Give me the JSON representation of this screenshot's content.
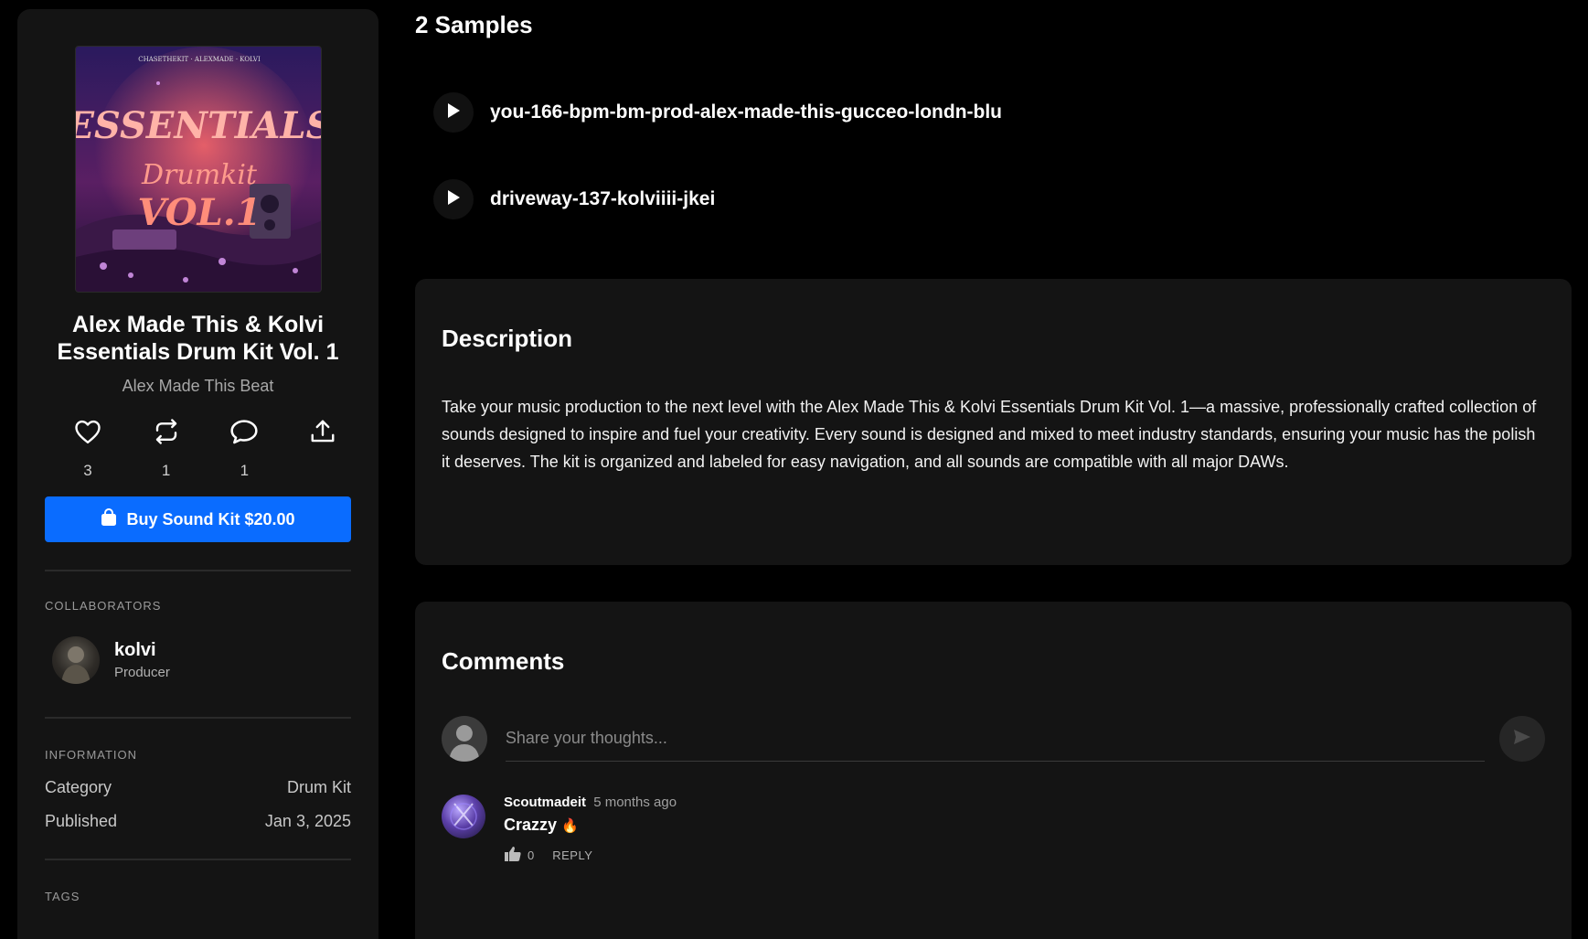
{
  "kit": {
    "title_line1": "Alex Made This & Kolvi",
    "title_line2": "Essentials Drum Kit Vol. 1",
    "author": "Alex Made This Beat",
    "cover_text": "ESSENTIALS"
  },
  "actions": [
    {
      "icon": "heart-icon",
      "count": "3"
    },
    {
      "icon": "repost-icon",
      "count": "1"
    },
    {
      "icon": "comment-icon",
      "count": "1"
    },
    {
      "icon": "share-icon",
      "count": ""
    }
  ],
  "buy": {
    "label": "Buy Sound Kit $20.00"
  },
  "collaborators": {
    "label": "COLLABORATORS",
    "items": [
      {
        "name": "kolvi",
        "role": "Producer"
      }
    ]
  },
  "information": {
    "label": "INFORMATION",
    "rows": [
      {
        "key": "Category",
        "value": "Drum Kit"
      },
      {
        "key": "Published",
        "value": "Jan 3, 2025"
      }
    ]
  },
  "tags": {
    "label": "TAGS"
  },
  "samples": {
    "title": "2 Samples",
    "items": [
      {
        "name": "you-166-bpm-bm-prod-alex-made-this-gucceo-londn-blu"
      },
      {
        "name": "driveway-137-kolviiii-jkei"
      }
    ]
  },
  "description": {
    "title": "Description",
    "text": "Take your music production to the next level with the Alex Made This & Kolvi Essentials Drum Kit Vol. 1—a massive, professionally crafted collection of sounds designed to inspire and fuel your creativity. Every sound is designed and mixed to meet industry standards, ensuring your music has the polish it deserves. The kit is organized and labeled for easy navigation, and all sounds are compatible with all major DAWs."
  },
  "comments": {
    "title": "Comments",
    "placeholder": "Share your thoughts...",
    "items": [
      {
        "user": "Scoutmadeit",
        "time": "5 months ago",
        "text": "Crazzy",
        "emoji": "🔥",
        "likes": "0",
        "reply_label": "REPLY"
      }
    ]
  },
  "colors": {
    "accent": "#0a6cff",
    "panel": "#141414",
    "background": "#000000"
  }
}
